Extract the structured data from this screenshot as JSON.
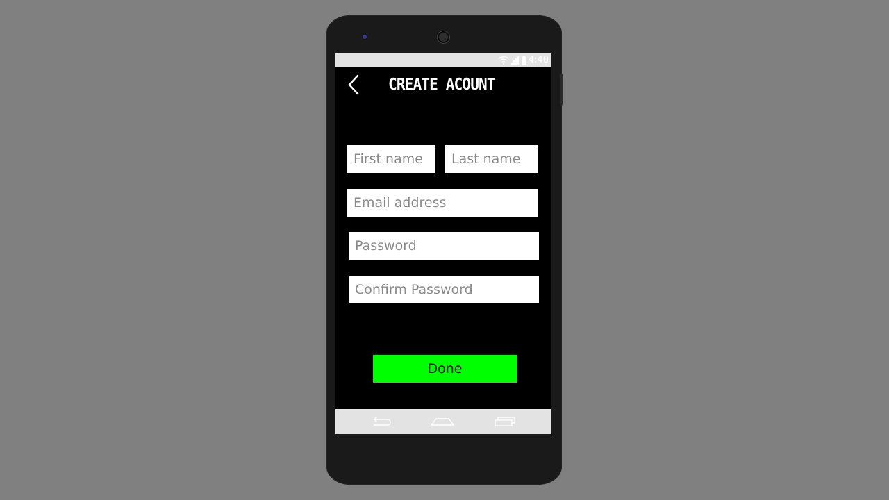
{
  "status_bar": {
    "time": "4:40",
    "icons": [
      "wifi-icon",
      "signal-icon",
      "battery-icon"
    ]
  },
  "header": {
    "title": "CREATE ACOUNT",
    "back_icon": "chevron-left-icon"
  },
  "form": {
    "first_name": {
      "value": "",
      "placeholder": "First name"
    },
    "last_name": {
      "value": "",
      "placeholder": "Last name"
    },
    "email": {
      "value": "",
      "placeholder": "Email address"
    },
    "password": {
      "value": "",
      "placeholder": "Password"
    },
    "confirm_password": {
      "value": "",
      "placeholder": "Confirm Password"
    },
    "submit_label": "Done"
  },
  "nav_bar": {
    "buttons": [
      "back-nav-icon",
      "home-nav-icon",
      "recents-nav-icon"
    ]
  },
  "colors": {
    "background": "#808080",
    "phone_body": "#1a1a1a",
    "screen": "#000000",
    "accent": "#00ff00",
    "system_bars": "#e3e3e3"
  }
}
